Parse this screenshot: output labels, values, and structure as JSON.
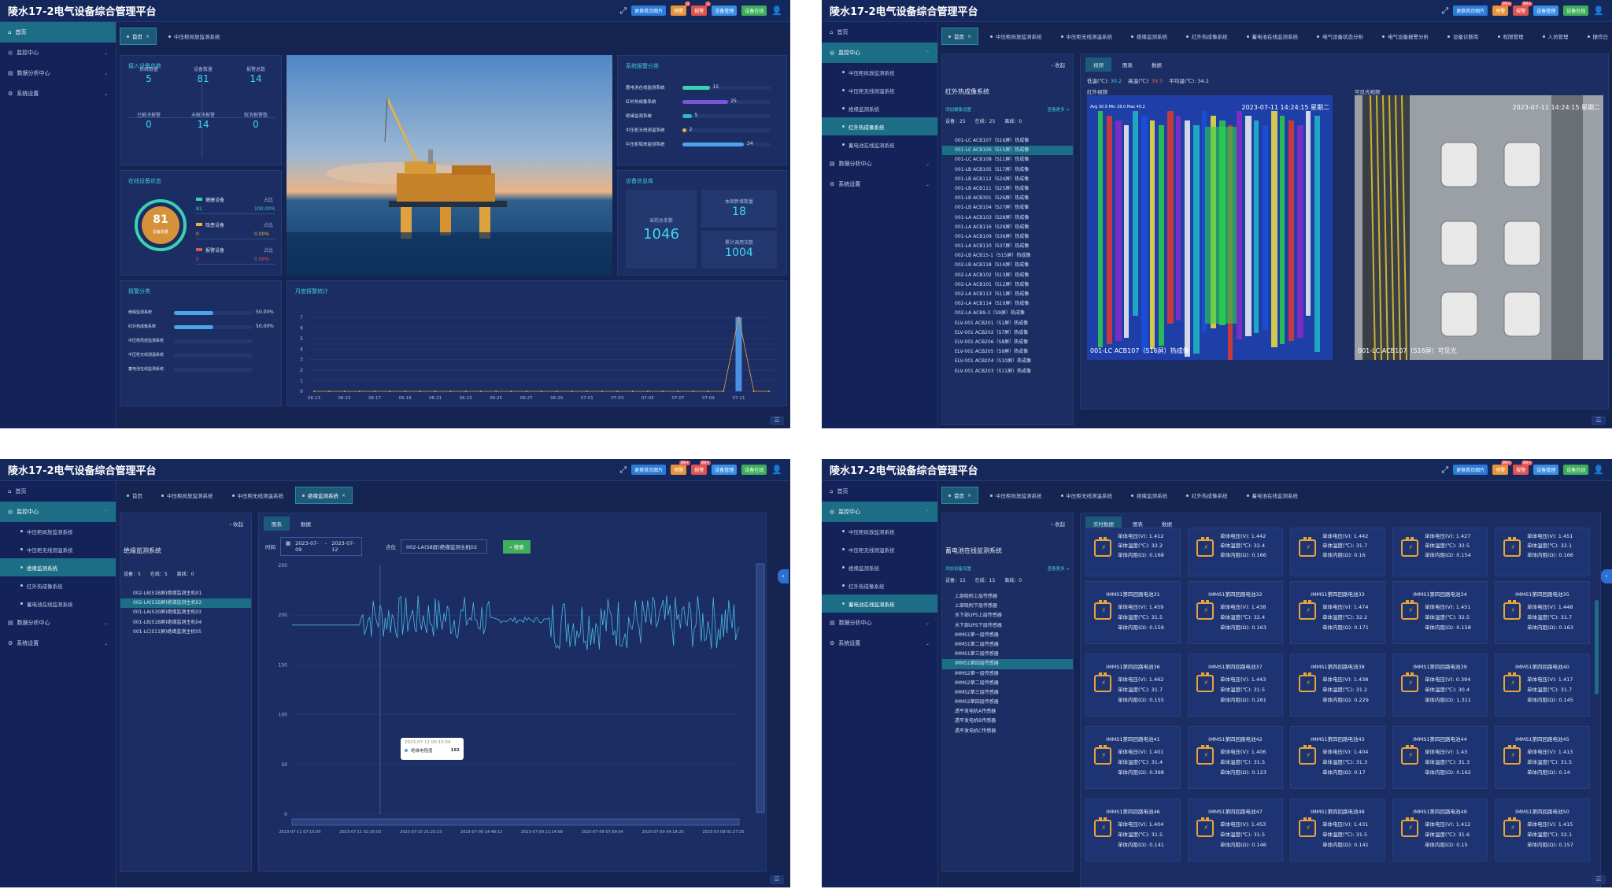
{
  "app": {
    "title": "陵水17-2电气设备综合管理平台"
  },
  "header": {
    "btn_img": "更换首页图片",
    "btn_warn": "预警",
    "btn_alarm": "报警",
    "btn_equip": "设备管理",
    "btn_ok": "设备在线",
    "badge_warn": "99+",
    "badge_alarm": "99+",
    "warn_badge_p1": "0",
    "alarm_badge_p1": "1"
  },
  "nav": {
    "home": "首页",
    "monitor": "监控中心",
    "analysis": "数据分析中心",
    "settings": "系统设置"
  },
  "subnav": [
    "中压柜局放监测系统",
    "中压柜无线测温系统",
    "绝缘监测系统",
    "红外热成像系统",
    "蓄电池在线监测系统"
  ],
  "p1": {
    "tabs": [
      "首页",
      "中压柜局放监测系统"
    ],
    "access": {
      "title": "接入设备总数",
      "items": [
        {
          "l": "系统数量",
          "v": "5"
        },
        {
          "l": "设备数量",
          "v": "81"
        },
        {
          "l": "报警总数",
          "v": "14"
        },
        {
          "l": "已解决报警",
          "v": "0"
        },
        {
          "l": "未解决报警",
          "v": "14"
        },
        {
          "l": "取消报警数",
          "v": "0"
        }
      ]
    },
    "online": {
      "title": "在线设备状态",
      "center": "81",
      "center_lbl": "设备数量",
      "items": [
        {
          "n": "健康设备",
          "c": "#3bd1b1",
          "cnt": "81",
          "pct": "100.00%",
          "tag": "占比"
        },
        {
          "n": "隐患设备",
          "c": "#f0b03a",
          "cnt": "0",
          "pct": "0.00%",
          "tag": "占比"
        },
        {
          "n": "报警设备",
          "c": "#e0524d",
          "cnt": "0",
          "pct": "0.00%",
          "tag": "占比"
        }
      ]
    },
    "sysalarm": {
      "title": "系统报警分类",
      "items": [
        {
          "n": "蓄电池在线监测系统",
          "v": 15,
          "c": "#3bd1b1"
        },
        {
          "n": "红外热成像系统",
          "v": 25,
          "c": "#7a55d6"
        },
        {
          "n": "绝缘监测系统",
          "v": 5,
          "c": "#2bb8d8"
        },
        {
          "n": "中压柜无线测温系统",
          "v": 2,
          "c": "#f0b03a"
        },
        {
          "n": "中压柜局放监测系统",
          "v": 34,
          "c": "#4aa6e8"
        }
      ]
    },
    "lib": {
      "title": "设备信息库",
      "total_l": "当前总条数",
      "total_v": "1046",
      "add_l": "本周新增数量",
      "add_v": "18",
      "call_l": "累计调用次数",
      "call_v": "1004"
    },
    "alarmcat": {
      "title": "报警分类",
      "items": [
        {
          "n": "绝缘监测系统",
          "p": "50.00%",
          "f": 0.5
        },
        {
          "n": "红外热成像系统",
          "p": "50.00%",
          "f": 0.5
        },
        {
          "n": "中压柜局放监测系统",
          "p": "",
          "f": 0
        },
        {
          "n": "中压柜无线测温系统",
          "p": "",
          "f": 0
        },
        {
          "n": "蓄电池在线监测系统",
          "p": "",
          "f": 0
        }
      ]
    }
  },
  "chart_data": [
    {
      "type": "line",
      "title": "月度报警统计",
      "x": [
        "06-13",
        "06-15",
        "06-17",
        "06-19",
        "06-21",
        "06-23",
        "06-25",
        "06-27",
        "06-29",
        "07-01",
        "07-03",
        "07-05",
        "07-07",
        "07-09",
        "07-11"
      ],
      "daily": [
        0,
        0,
        0,
        0,
        0,
        0,
        0,
        0,
        0,
        0,
        0,
        0,
        0,
        0,
        0,
        0,
        0,
        0,
        0,
        0,
        0,
        0,
        0,
        0,
        0,
        0,
        0,
        0,
        7,
        0,
        0
      ],
      "yticks": [
        0,
        1,
        2,
        3,
        4,
        5,
        6,
        7
      ],
      "ylim": [
        0,
        7
      ]
    },
    {
      "type": "line",
      "series_name": "绝缘电阻值",
      "yticks": [
        0,
        50,
        100,
        150,
        200,
        250
      ],
      "ylim": [
        0,
        250
      ],
      "xlabels": [
        "2023-07-11 07:15:00",
        "2023-07-11 02:30:02",
        "2023-07-10 21:23:23",
        "2023-07-09 14:48:12",
        "2023-07-09 11:24:09",
        "2023-07-09 07:09:04",
        "2023-07-09 04:18:20",
        "2023-07-09 01:27:20"
      ],
      "tooltip": {
        "time": "2023-07-11 00:15:04",
        "name": "绝缘电阻值",
        "value": "192"
      }
    }
  ],
  "p2": {
    "tabs": [
      "首页",
      "中压柜局放监测系统",
      "中压柜无线测温系统",
      "绝缘监测系统",
      "红外热成像系统",
      "蓄电池在线监测系统",
      "电气设备状态分析",
      "电气设备报警分析",
      "设备诊断库",
      "权限管理",
      "人员管理",
      "操作日"
    ],
    "collapse": "收起",
    "systitle": "红外热成像系统",
    "addset": "添加摄像设置",
    "more": "查看更多 >",
    "stat": {
      "dev": "设备：25",
      "on": "在线：25",
      "off": "离线：0"
    },
    "list": [
      "001-LC ACB107（S16屏）热成像",
      "001-LC ACB106（S15屏）热成像",
      "001-LC ACB108（S11屏）热成像",
      "001-LB ACB105（S17屏）热成像",
      "001-LB ACB112（S24屏）热成像",
      "001-LB ACB111（S25屏）热成像",
      "001-LB ACB301（S26屏）热成像",
      "001-LB ACB104（S27屏）热成像",
      "001-LA ACB103（S28屏）热成像",
      "001-LA ACB116（S29屏）热成像",
      "001-LA ACB109（S36屏）热成像",
      "001-LA ACB110（S37屏）热成像",
      "002-LB ACB15-1（S15屏）热成像",
      "002-LB ACB118（S14屏）热成像",
      "002-LA ACB102（S13屏）热成像",
      "002-LA ACB101（S12屏）热成像",
      "002-LA ACB113（S11屏）热成像",
      "002-LA ACB114（S10屏）热成像",
      "002-LA ACB9-3（S9屏）热成像",
      "ELV-001 ACB201（S1屏）热成像",
      "ELV-001 ACB202（S7屏）热成像",
      "ELV-001 ACB206（S8屏）热成像",
      "ELV-001 ACB205（S9屏）热成像",
      "ELV-001 ACB204（S10屏）热成像",
      "ELV-001 ACB203（S11屏）热成像"
    ],
    "vtabs": [
      "视频",
      "图表",
      "数据"
    ],
    "temp": {
      "low_l": "低温(℃):",
      "low": "30.2",
      "high_l": "高温(℃):",
      "high": "39.5",
      "avg_l": "平均温(℃):",
      "avg": "34.2"
    },
    "ir_title": "红外视频",
    "vis_title": "可见光视频",
    "ir_ts": "2023-07-11 14:24:15 星期二",
    "ir_label": "001-LC ACB107（S16屏）热成像",
    "vis_ts": "2023-07-11 14:24:15 星期二",
    "vis_label": "001-LC ACB107（S16屏）可见光",
    "ir_hud": "Avg 30.9 Min 28.0 Max 40.2"
  },
  "p3": {
    "tabs": [
      "首页",
      "中压柜局放监测系统",
      "中压柜无线测温系统",
      "绝缘监测系统"
    ],
    "collapse": "收起",
    "systitle": "绝缘监测系统",
    "stat": {
      "dev": "设备：5",
      "on": "在线：5",
      "off": "离线：0"
    },
    "list": [
      "002-LB(S1B屏)绝缘监测主机01",
      "002-LA(S1B屏)绝缘监测主机02",
      "001-LA(S30屏)绝缘监测主机03",
      "001-LB(S1B屏)绝缘监测主机04",
      "001-LC(S11屏)绝缘监测主机05"
    ],
    "vtabs": [
      "图表",
      "数据"
    ],
    "time_l": "时间",
    "date_from": "2023-07-09",
    "date_sep": "-",
    "date_to": "2023-07-12",
    "point_l": "点位",
    "point_v": "002-LA(S8屏)绝缘监测主机02",
    "search": "搜索"
  },
  "p4": {
    "tabs": [
      "首页",
      "中压柜局放监测系统",
      "中压柜无线测温系统",
      "绝缘监测系统",
      "红外热成像系统",
      "蓄电池在线监测系统"
    ],
    "collapse": "收起",
    "systitle": "蓄电池在线监测系统",
    "addset": "添加设备设置",
    "more": "查看更多 >",
    "stat": {
      "dev": "设备：15",
      "on": "在线：15",
      "off": "离线：0"
    },
    "list": [
      "上部吸附上层传感器",
      "上部吸附下层传感器",
      "水下部UPS上层传感器",
      "水下部UPS下层传感器",
      "IMMS1第一层传感器",
      "IMMS1第二层传感器",
      "IMMS1第三层传感器",
      "IMMS1第四层传感器",
      "IMMS2第一层传感器",
      "IMMS2第二层传感器",
      "IMMS2第三层传感器",
      "IMMS2第四层传感器",
      "透平发电机A传感器",
      "透平发电机B传感器",
      "透平发电机C传感器"
    ],
    "vtabs": [
      "实时数据",
      "图表",
      "数据"
    ],
    "lv": "单体电压(V):",
    "lt": "单体温度(℃):",
    "lr": "单体内阻(Ω):",
    "top": [
      [
        "1.412",
        "32.2",
        "0.168"
      ],
      [
        "1.442",
        "32.4",
        "0.166"
      ],
      [
        "1.442",
        "31.7",
        "0.16"
      ],
      [
        "1.427",
        "32.5",
        "0.154"
      ],
      [
        "1.451",
        "32.1",
        "0.166"
      ]
    ],
    "cells": [
      {
        "n": "IMMS1第四回路电池31",
        "v": "1.459",
        "t": "31.5",
        "r": "0.159"
      },
      {
        "n": "IMMS1第四回路电池32",
        "v": "1.438",
        "t": "32.4",
        "r": "0.163"
      },
      {
        "n": "IMMS1第四回路电池33",
        "v": "1.474",
        "t": "32.2",
        "r": "0.171"
      },
      {
        "n": "IMMS1第四回路电池34",
        "v": "1.451",
        "t": "32.5",
        "r": "0.158"
      },
      {
        "n": "IMMS1第四回路电池35",
        "v": "1.448",
        "t": "31.7",
        "r": "0.163"
      },
      {
        "n": "IMMS1第四回路电池36",
        "v": "1.462",
        "t": "31.7",
        "r": "0.155"
      },
      {
        "n": "IMMS1第四回路电池37",
        "v": "1.443",
        "t": "31.5",
        "r": "0.261"
      },
      {
        "n": "IMMS1第四回路电池38",
        "v": "1.438",
        "t": "31.2",
        "r": "0.229"
      },
      {
        "n": "IMMS1第四回路电池39",
        "v": "0.394",
        "t": "30.4",
        "r": "1.311"
      },
      {
        "n": "IMMS1第四回路电池40",
        "v": "1.417",
        "t": "31.7",
        "r": "0.145"
      },
      {
        "n": "IMMS1第四回路电池41",
        "v": "1.401",
        "t": "31.4",
        "r": "0.398"
      },
      {
        "n": "IMMS1第四回路电池42",
        "v": "1.406",
        "t": "31.5",
        "r": "0.123"
      },
      {
        "n": "IMMS1第四回路电池43",
        "v": "1.404",
        "t": "31.3",
        "r": "0.17"
      },
      {
        "n": "IMMS1第四回路电池44",
        "v": "1.43",
        "t": "31.3",
        "r": "0.162"
      },
      {
        "n": "IMMS1第四回路电池45",
        "v": "1.413",
        "t": "31.5",
        "r": "0.14"
      },
      {
        "n": "IMMS1第四回路电池46",
        "v": "1.404",
        "t": "31.5",
        "r": "0.141"
      },
      {
        "n": "IMMS1第四回路电池47",
        "v": "1.453",
        "t": "31.5",
        "r": "0.146"
      },
      {
        "n": "IMMS1第四回路电池48",
        "v": "1.431",
        "t": "31.5",
        "r": "0.141"
      },
      {
        "n": "IMMS1第四回路电池49",
        "v": "1.412",
        "t": "31.6",
        "r": "0.15"
      },
      {
        "n": "IMMS1第四回路电池50",
        "v": "1.415",
        "t": "32.1",
        "r": "0.157"
      }
    ]
  }
}
